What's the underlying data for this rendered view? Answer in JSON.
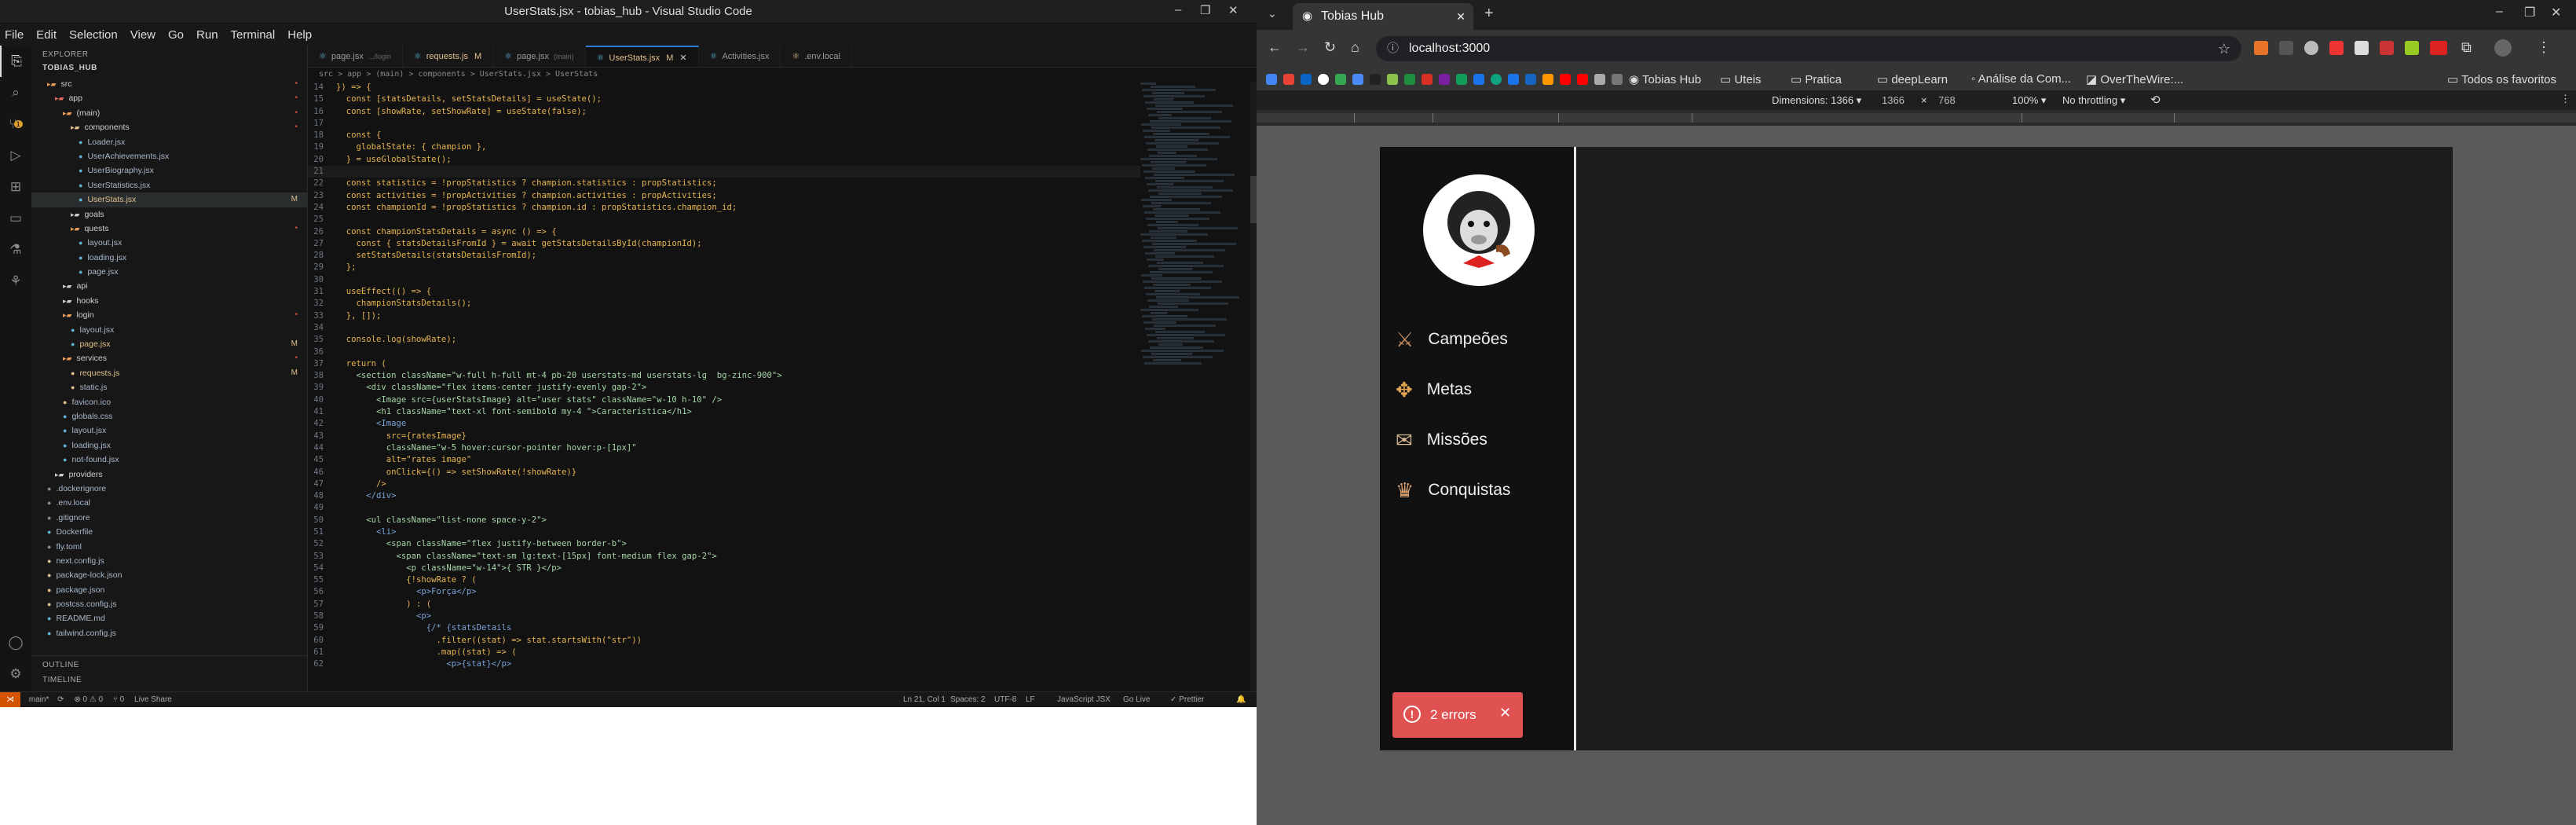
{
  "vscode": {
    "window_title": "UserStats.jsx - tobias_hub - Visual Studio Code",
    "menu": [
      "File",
      "Edit",
      "Selection",
      "View",
      "Go",
      "Run",
      "Terminal",
      "Help"
    ],
    "explorer": {
      "header": "EXPLORER",
      "root": "TOBIAS_HUB",
      "items": [
        {
          "name": "src",
          "indent": 1,
          "kind": "folder",
          "color": "#e89b58",
          "badge": "•"
        },
        {
          "name": "app",
          "indent": 2,
          "kind": "folder",
          "color": "#e26a5c",
          "badge": "•"
        },
        {
          "name": "(main)",
          "indent": 3,
          "kind": "folder",
          "color": "#e89b58",
          "badge": "•"
        },
        {
          "name": "components",
          "indent": 4,
          "kind": "folder",
          "color": "#e2c08d",
          "badge": "•"
        },
        {
          "name": "Loader.jsx",
          "indent": 5,
          "kind": "file",
          "color": "#5bb4d4",
          "badge": ""
        },
        {
          "name": "UserAchievements.jsx",
          "indent": 5,
          "kind": "file",
          "color": "#5bb4d4",
          "badge": ""
        },
        {
          "name": "UserBiography.jsx",
          "indent": 5,
          "kind": "file",
          "color": "#5bb4d4",
          "badge": ""
        },
        {
          "name": "UserStatistics.jsx",
          "indent": 5,
          "kind": "file",
          "color": "#5bb4d4",
          "badge": ""
        },
        {
          "name": "UserStats.jsx",
          "indent": 5,
          "kind": "file",
          "color": "#5bb4d4",
          "badge": "M",
          "active": true
        },
        {
          "name": "goals",
          "indent": 4,
          "kind": "folder",
          "color": "#cccccc",
          "badge": ""
        },
        {
          "name": "quests",
          "indent": 4,
          "kind": "folder",
          "color": "#e89b58",
          "badge": "•"
        },
        {
          "name": "layout.jsx",
          "indent": 5,
          "kind": "file",
          "color": "#5bb4d4",
          "badge": ""
        },
        {
          "name": "loading.jsx",
          "indent": 5,
          "kind": "file",
          "color": "#5bb4d4",
          "badge": ""
        },
        {
          "name": "page.jsx",
          "indent": 5,
          "kind": "file",
          "color": "#5bb4d4",
          "badge": ""
        },
        {
          "name": "api",
          "indent": 3,
          "kind": "folder",
          "color": "#cccccc",
          "badge": ""
        },
        {
          "name": "hooks",
          "indent": 3,
          "kind": "folder",
          "color": "#cccccc",
          "badge": ""
        },
        {
          "name": "login",
          "indent": 3,
          "kind": "folder",
          "color": "#e89b58",
          "badge": "•"
        },
        {
          "name": "layout.jsx",
          "indent": 4,
          "kind": "file",
          "color": "#5bb4d4",
          "badge": ""
        },
        {
          "name": "page.jsx",
          "indent": 4,
          "kind": "file",
          "color": "#5bb4d4",
          "badge": "M"
        },
        {
          "name": "services",
          "indent": 3,
          "kind": "folder",
          "color": "#e89b58",
          "badge": "•"
        },
        {
          "name": "requests.js",
          "indent": 4,
          "kind": "file",
          "color": "#e2c08d",
          "badge": "M"
        },
        {
          "name": "static.js",
          "indent": 4,
          "kind": "file",
          "color": "#e2c08d",
          "badge": ""
        },
        {
          "name": "favicon.ico",
          "indent": 3,
          "kind": "file",
          "color": "#e2c08d",
          "badge": ""
        },
        {
          "name": "globals.css",
          "indent": 3,
          "kind": "file",
          "color": "#5bb4d4",
          "badge": ""
        },
        {
          "name": "layout.jsx",
          "indent": 3,
          "kind": "file",
          "color": "#5bb4d4",
          "badge": ""
        },
        {
          "name": "loading.jsx",
          "indent": 3,
          "kind": "file",
          "color": "#5bb4d4",
          "badge": ""
        },
        {
          "name": "not-found.jsx",
          "indent": 3,
          "kind": "file",
          "color": "#5bb4d4",
          "badge": ""
        },
        {
          "name": "providers",
          "indent": 2,
          "kind": "folder",
          "color": "#cccccc",
          "badge": ""
        },
        {
          "name": ".dockerignore",
          "indent": 1,
          "kind": "file",
          "color": "#8a8a8a",
          "badge": ""
        },
        {
          "name": ".env.local",
          "indent": 1,
          "kind": "file",
          "color": "#8a8a8a",
          "badge": ""
        },
        {
          "name": ".gitignore",
          "indent": 1,
          "kind": "file",
          "color": "#8a8a8a",
          "badge": ""
        },
        {
          "name": "Dockerfile",
          "indent": 1,
          "kind": "file",
          "color": "#5bb4d4",
          "badge": ""
        },
        {
          "name": "fly.toml",
          "indent": 1,
          "kind": "file",
          "color": "#8a8a8a",
          "badge": ""
        },
        {
          "name": "next.config.js",
          "indent": 1,
          "kind": "file",
          "color": "#e2c08d",
          "badge": ""
        },
        {
          "name": "package-lock.json",
          "indent": 1,
          "kind": "file",
          "color": "#e2c08d",
          "badge": ""
        },
        {
          "name": "package.json",
          "indent": 1,
          "kind": "file",
          "color": "#e2c08d",
          "badge": ""
        },
        {
          "name": "postcss.config.js",
          "indent": 1,
          "kind": "file",
          "color": "#e2c08d",
          "badge": ""
        },
        {
          "name": "README.md",
          "indent": 1,
          "kind": "file",
          "color": "#5bb4d4",
          "badge": ""
        },
        {
          "name": "tailwind.config.js",
          "indent": 1,
          "kind": "file",
          "color": "#5bb4d4",
          "badge": ""
        }
      ],
      "outline": "OUTLINE",
      "timeline": "TIMELINE"
    },
    "tabs": [
      {
        "label": "page.jsx",
        "hint": ".../login",
        "badge": ""
      },
      {
        "label": "requests.js",
        "hint": "",
        "badge": "M"
      },
      {
        "label": "page.jsx",
        "hint": "(main)",
        "badge": ""
      },
      {
        "label": "UserStats.jsx",
        "hint": "",
        "badge": "M",
        "active": true
      },
      {
        "label": "Activities.jsx",
        "hint": "",
        "badge": ""
      },
      {
        "label": ".env.local",
        "hint": "",
        "badge": ""
      }
    ],
    "breadcrumb": "src > app > (main) > components > UserStats.jsx > UserStats",
    "code_start_line": 14,
    "code": [
      "}) => {",
      "  const [statsDetails, setStatsDetails] = useState();",
      "  const [showRate, setShowRate] = useState(false);",
      "",
      "  const {",
      "    globalState: { champion },",
      "  } = useGlobalState();",
      "",
      "  const statistics = !propStatistics ? champion.statistics : propStatistics;",
      "  const activities = !propActivities ? champion.activities : propActivities;",
      "  const championId = !propStatistics ? champion.id : propStatistics.champion_id;",
      "",
      "  const championStatsDetails = async () => {",
      "    const { statsDetailsFromId } = await getStatsDetailsById(championId);",
      "    setStatsDetails(statsDetailsFromId);",
      "  };",
      "",
      "  useEffect(() => {",
      "    championStatsDetails();",
      "  }, []);",
      "",
      "  console.log(showRate);",
      "",
      "  return (",
      "    <section className=\"w-full h-full mt-4 pb-20 userstats-md userstats-lg  bg-zinc-900\">",
      "      <div className=\"flex items-center justify-evenly gap-2\">",
      "        <Image src={userStatsImage} alt=\"user stats\" className=\"w-10 h-10\" />",
      "        <h1 className=\"text-xl font-semibold my-4 \">Característica</h1>",
      "        <Image",
      "          src={ratesImage}",
      "          className=\"w-5 hover:cursor-pointer hover:p-[1px]\"",
      "          alt=\"rates image\"",
      "          onClick={() => setShowRate(!showRate)}",
      "        />",
      "      </div>",
      "",
      "      <ul className=\"list-none space-y-2\">",
      "        <li>",
      "          <span className=\"flex justify-between border-b\">",
      "            <span className=\"text-sm lg:text-[15px] font-medium flex gap-2\">",
      "              <p className=\"w-14\">{ STR }</p>",
      "              {!showRate ? (",
      "                <p>Força</p>",
      "              ) : (",
      "                <p>",
      "                  {/* {statsDetails",
      "                    .filter((stat) => stat.startsWith(\"str\"))",
      "                    .map((stat) => (",
      "                      <p>{stat}</p>"
    ],
    "current_line": 21,
    "status": {
      "branch": "main*",
      "sync": "⟳",
      "problems": "⊗ 0  ⚠ 0",
      "ports": "⑂ 0",
      "live": "Live Share",
      "position": "Ln 21, Col 1",
      "spaces": "Spaces: 2",
      "encoding": "UTF-8",
      "eol": "LF",
      "lang": "JavaScript JSX",
      "golive": "Go Live",
      "prettier": "✓ Prettier"
    }
  },
  "chrome": {
    "tab_title": "Tobias Hub",
    "url": "localhost:3000",
    "bookmarks": [
      "Tobias Hub",
      "Uteis",
      "Pratica",
      "deepLearn",
      "Análise da Com...",
      "OverTheWire:...",
      "Todos os favoritos"
    ],
    "devtools": {
      "dimensions_label": "Dimensions: 1366",
      "width": "1366",
      "x": "×",
      "height": "768",
      "zoom": "100%",
      "throttle": "No throttling"
    },
    "app": {
      "nav": [
        {
          "label": "Campeões",
          "icon": "champions-icon"
        },
        {
          "label": "Metas",
          "icon": "goals-icon"
        },
        {
          "label": "Missões",
          "icon": "quests-icon"
        },
        {
          "label": "Conquistas",
          "icon": "achievements-icon"
        }
      ],
      "error_toast": "2 errors"
    }
  }
}
